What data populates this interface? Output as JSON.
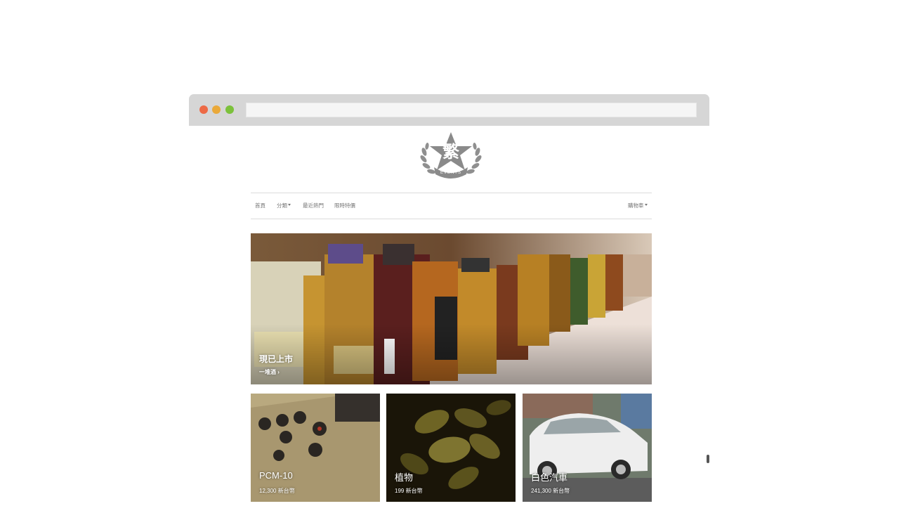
{
  "logo": {
    "char": "繁",
    "text": "EVENTS"
  },
  "nav": {
    "home": "首頁",
    "categories": "分類",
    "recent_hot": "最近熱門",
    "limited_offer": "限時特價",
    "cart": "購物車"
  },
  "hero": {
    "title": "現已上市",
    "subtitle": "一堆酒 ›"
  },
  "products": [
    {
      "name": "PCM-10",
      "price": "12,300 新台幣"
    },
    {
      "name": "植物",
      "price": "199 新台幣"
    },
    {
      "name": "白色汽車",
      "price": "241,300 新台幣"
    }
  ],
  "colors": {
    "dot_red": "#ed6a46",
    "dot_yellow": "#eaa93a",
    "dot_green": "#7cc13b",
    "nav_text": "#777777",
    "logo_gray": "#8a8a8a"
  }
}
